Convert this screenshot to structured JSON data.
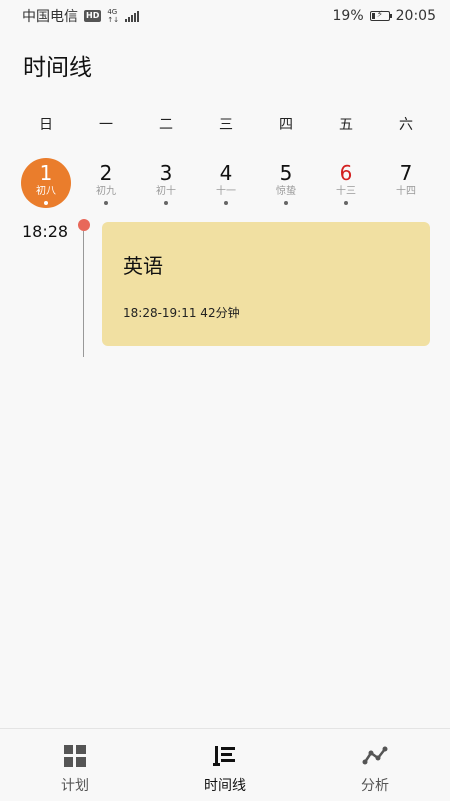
{
  "status_bar": {
    "carrier": "中国电信",
    "hd": "HD",
    "network_top": "4G",
    "network_bottom": "↑↓",
    "battery_percent": "19%",
    "time": "20:05"
  },
  "page": {
    "title": "时间线"
  },
  "week": {
    "day_names": [
      "日",
      "一",
      "二",
      "三",
      "四",
      "五",
      "六"
    ],
    "dates": [
      {
        "num": "1",
        "lunar": "初八",
        "selected": true,
        "red": false,
        "has_dot": true
      },
      {
        "num": "2",
        "lunar": "初九",
        "selected": false,
        "red": false,
        "has_dot": true
      },
      {
        "num": "3",
        "lunar": "初十",
        "selected": false,
        "red": false,
        "has_dot": true
      },
      {
        "num": "4",
        "lunar": "十一",
        "selected": false,
        "red": false,
        "has_dot": true
      },
      {
        "num": "5",
        "lunar": "惊蛰",
        "selected": false,
        "red": false,
        "has_dot": true
      },
      {
        "num": "6",
        "lunar": "十三",
        "selected": false,
        "red": true,
        "has_dot": true
      },
      {
        "num": "7",
        "lunar": "十四",
        "selected": false,
        "red": false,
        "has_dot": false
      }
    ]
  },
  "timeline": {
    "start_time": "18:28",
    "event": {
      "title": "英语",
      "time_range": "18:28-19:11 42分钟"
    }
  },
  "bottom_nav": {
    "items": [
      {
        "label": "计划",
        "icon": "grid-icon",
        "active": false
      },
      {
        "label": "时间线",
        "icon": "timeline-icon",
        "active": true
      },
      {
        "label": "分析",
        "icon": "trend-icon",
        "active": false
      }
    ]
  },
  "colors": {
    "selected_date": "#ea7d2c",
    "sunday_red": "#d32020",
    "event_card": "#f1e0a2",
    "timeline_dot": "#e8685a"
  }
}
